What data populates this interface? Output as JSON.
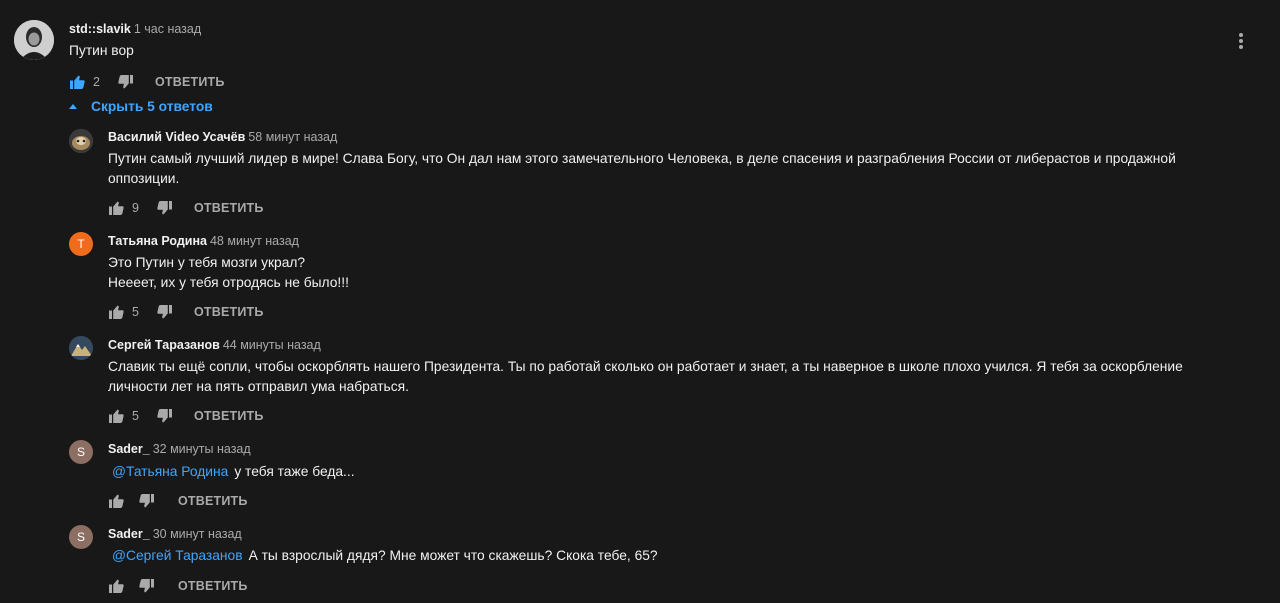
{
  "comment": {
    "author": "std::slavik",
    "time": "1 час назад",
    "text": "Путин вор",
    "likes": "2",
    "reply_label": "ОТВЕТИТЬ"
  },
  "replies_toggle": {
    "label": "Скрыть 5 ответов"
  },
  "replies": [
    {
      "author": "Василий Video Усачёв",
      "time": "58 минут назад",
      "mention": "",
      "lines": [
        "Путин самый лучший лидер в мире! Слава Богу, что Он дал нам этого замечательного Человека, в деле спасения и разграбления России от либерастов и продажной",
        "оппозиции."
      ],
      "likes": "9",
      "reply_label": "ОТВЕТИТЬ"
    },
    {
      "author": "Татьяна Родина",
      "time": "48 минут назад",
      "avatar_letter": "Т",
      "mention": "",
      "lines": [
        "Это Путин у тебя мозги украл?",
        "Неееет, их у тебя отродясь не было!!!"
      ],
      "likes": "5",
      "reply_label": "ОТВЕТИТЬ"
    },
    {
      "author": "Сергей Таразанов",
      "time": "44 минуты назад",
      "mention": "",
      "lines": [
        "Славик ты ещё сопли, чтобы оскорблять нашего Президента. Ты по работай сколько он работает и знает, а ты наверное в школе плохо учился. Я тебя за оскорбление",
        "личности лет на пять отправил ума набраться."
      ],
      "likes": "5",
      "reply_label": "ОТВЕТИТЬ"
    },
    {
      "author": "Sader_",
      "time": "32 минуты назад",
      "avatar_letter": "S",
      "mention": "@Татьяна Родина",
      "lines": [
        "у тебя таже беда..."
      ],
      "likes": "",
      "reply_label": "ОТВЕТИТЬ"
    },
    {
      "author": "Sader_",
      "time": "30 минут назад",
      "avatar_letter": "S",
      "mention": "@Сергей Таразанов",
      "lines": [
        "А ты взрослый дядя? Мне может что скажешь? Скока тебе, 65?"
      ],
      "likes": "",
      "reply_label": "ОТВЕТИТЬ"
    }
  ],
  "colors": {
    "background": "#181818",
    "text": "#f1f1f1",
    "secondary": "#aaaaaa",
    "link": "#3ea6ff",
    "avatar_orange": "#ef6c1c",
    "avatar_brown": "#8d6e63"
  },
  "icons": [
    "like-icon",
    "like-filled-icon",
    "dislike-icon",
    "more-vert-icon",
    "caret-up-icon"
  ]
}
